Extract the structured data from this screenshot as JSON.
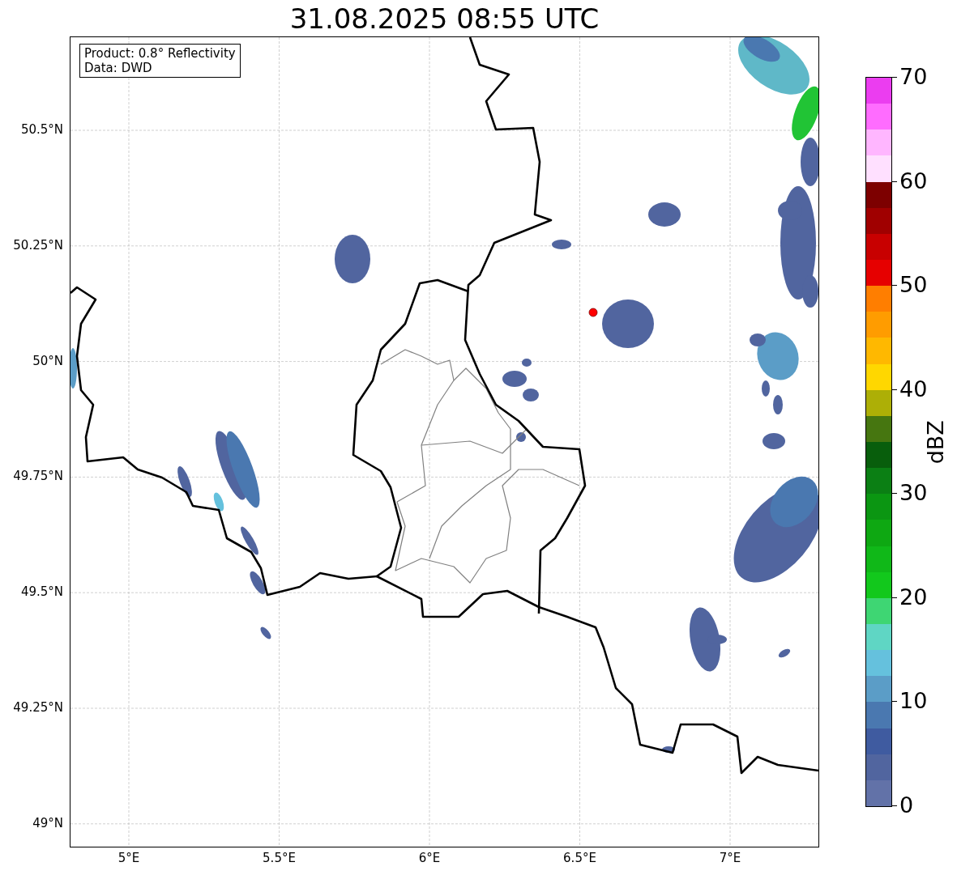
{
  "title": "31.08.2025 08:55 UTC",
  "info_box": {
    "lines": [
      "Product: 0.8° Reflectivity",
      "Data: DWD"
    ]
  },
  "lat_ticks": [
    "50.5°N",
    "50.25°N",
    "50°N",
    "49.75°N",
    "49.5°N",
    "49.25°N",
    "49°N"
  ],
  "lon_ticks": [
    "5°E",
    "5.5°E",
    "6°E",
    "6.5°E",
    "7°E"
  ],
  "colorbar": {
    "label": "dBZ",
    "ticks": [
      "70",
      "60",
      "50",
      "40",
      "30",
      "20",
      "10",
      "0"
    ],
    "bins": [
      {
        "color": "#6272a8"
      },
      {
        "color": "#51659f"
      },
      {
        "color": "#3f5ba0"
      },
      {
        "color": "#4a78b0"
      },
      {
        "color": "#5b9dc7"
      },
      {
        "color": "#65c1dd"
      },
      {
        "color": "#5fd6c4"
      },
      {
        "color": "#3ed673"
      },
      {
        "color": "#12c81c"
      },
      {
        "color": "#10b818"
      },
      {
        "color": "#0ea812"
      },
      {
        "color": "#0b9612"
      },
      {
        "color": "#0b7f14"
      },
      {
        "color": "#085e0c"
      },
      {
        "color": "#467610"
      },
      {
        "color": "#adaf06"
      },
      {
        "color": "#ffd700"
      },
      {
        "color": "#ffb800"
      },
      {
        "color": "#ff9c00"
      },
      {
        "color": "#ff7e00"
      },
      {
        "color": "#e60000"
      },
      {
        "color": "#c80000"
      },
      {
        "color": "#a00000"
      },
      {
        "color": "#7d0000"
      },
      {
        "color": "#ffe0ff"
      },
      {
        "color": "#ffb6ff"
      },
      {
        "color": "#ff6cff"
      },
      {
        "color": "#eb3df0"
      }
    ]
  }
}
